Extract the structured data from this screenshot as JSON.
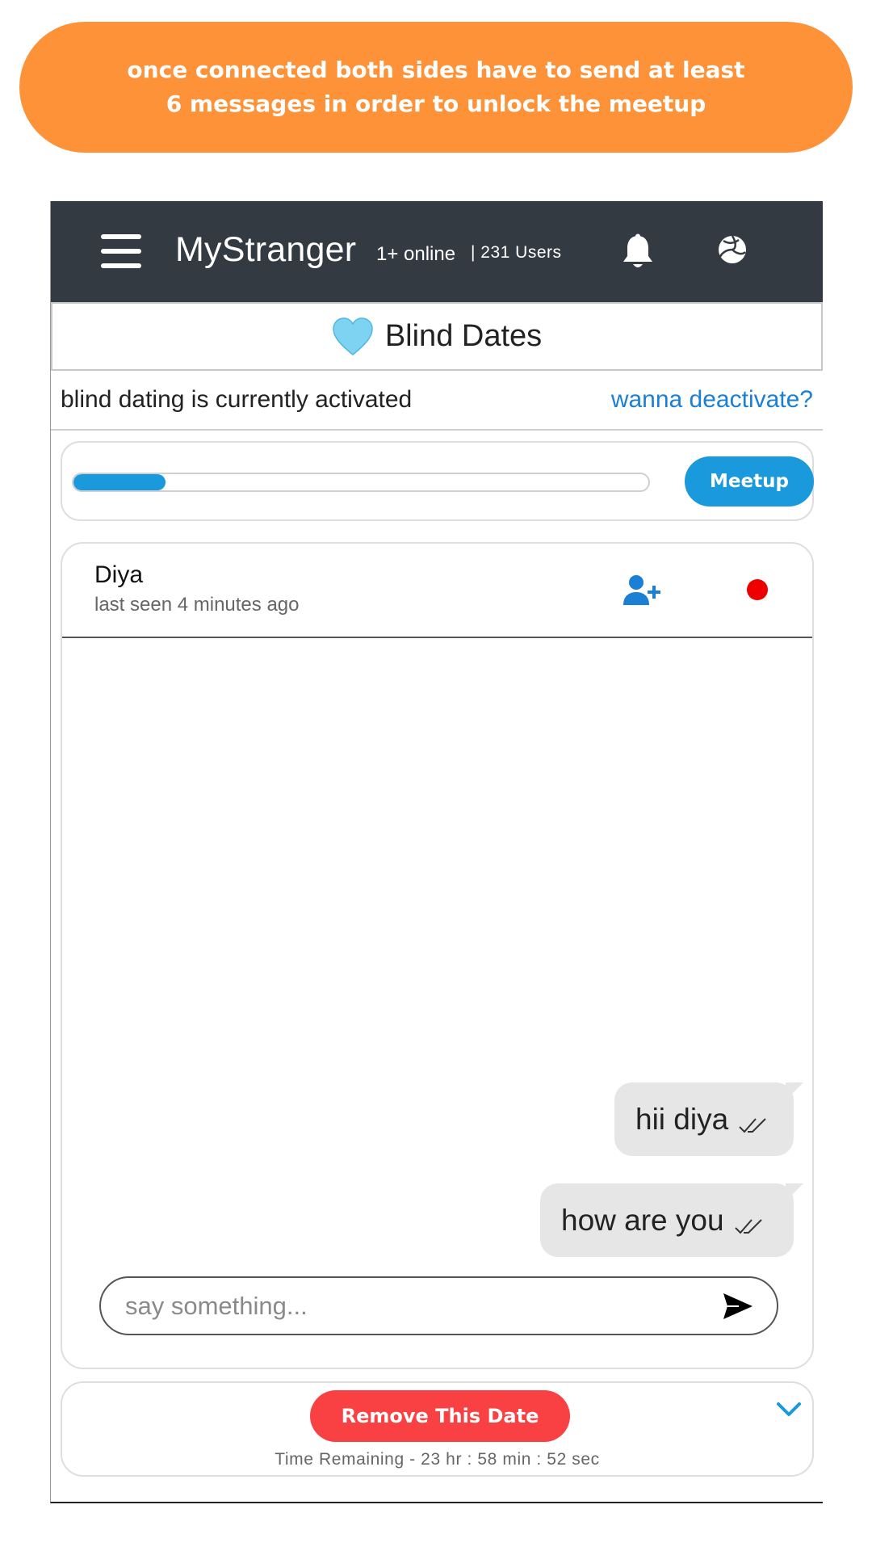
{
  "banner": {
    "text": "once connected both sides have to send at least 6 messages in order to unlock the meetup",
    "color": "#fe9238"
  },
  "navbar": {
    "menu_icon": "hamburger-icon",
    "brand": "MyStranger",
    "online": "1+ online",
    "users": "| 231 Users",
    "bell_icon": "bell-icon",
    "profile_icon": "volleyball-icon",
    "background": "#343a42"
  },
  "section": {
    "icon": "light-blue-heart-icon",
    "title": "Blind Dates"
  },
  "status": {
    "text": "blind dating is currently activated",
    "link": "wanna deactivate?"
  },
  "progress": {
    "fraction": 0.16,
    "meetup_label": "Meetup",
    "accent": "#1a99dc"
  },
  "chat": {
    "contact_name": "Diya",
    "last_seen": "last seen 4 minutes ago",
    "add_friend_icon": "user-plus-icon",
    "status_dot_color": "#ee0000",
    "messages": [
      {
        "text": "hii diya",
        "status_icon": "double-check-icon"
      },
      {
        "text": "how are you",
        "status_icon": "double-check-icon"
      }
    ],
    "composer": {
      "placeholder": "say something...",
      "value": "",
      "send_icon": "send-icon"
    }
  },
  "footer": {
    "remove_label": "Remove This Date",
    "time_remaining": "Time Remaining - 23 hr : 58 min : 52 sec",
    "collapse_icon": "chevron-down-icon",
    "remove_color": "#f94144"
  }
}
